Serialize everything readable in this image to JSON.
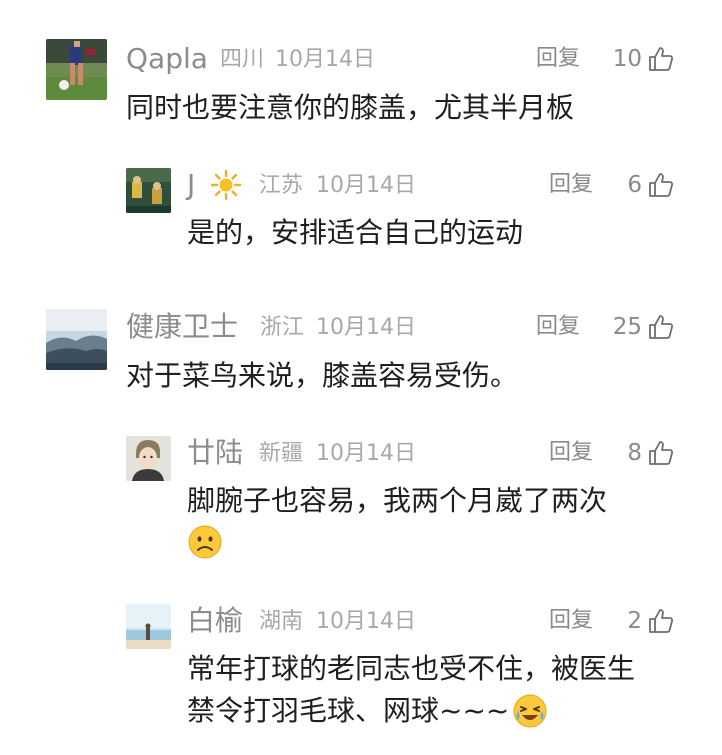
{
  "comments": [
    {
      "name": "Qapla",
      "region": "四川",
      "date": "10月14日",
      "reply_label": "回复",
      "likes": "10",
      "text": "同时也要注意你的膝盖，尤其半月板"
    },
    {
      "name": "J",
      "region": "江苏",
      "date": "10月14日",
      "reply_label": "回复",
      "likes": "6",
      "text": "是的，安排适合自己的运动"
    },
    {
      "name": "健康卫士",
      "region": "浙江",
      "date": "10月14日",
      "reply_label": "回复",
      "likes": "25",
      "text": "对于菜鸟来说，膝盖容易受伤。"
    },
    {
      "name": "廿陆",
      "region": "新疆",
      "date": "10月14日",
      "reply_label": "回复",
      "likes": "8",
      "text": "脚腕子也容易，我两个月崴了两次"
    },
    {
      "name": "白榆",
      "region": "湖南",
      "date": "10月14日",
      "reply_label": "回复",
      "likes": "2",
      "text_line1": "常年打球的老同志也受不住，被医生",
      "text_line2": "禁令打羽毛球、网球~~~"
    }
  ],
  "icons": {
    "like": "thumbs-up-outline-icon",
    "sun": "sun-icon",
    "sad": "sad-face-emoji",
    "laugh": "laughing-crying-emoji"
  },
  "colors": {
    "name": "#8c8c8c",
    "meta": "#a8a8a8",
    "text": "#1f1f1f"
  }
}
